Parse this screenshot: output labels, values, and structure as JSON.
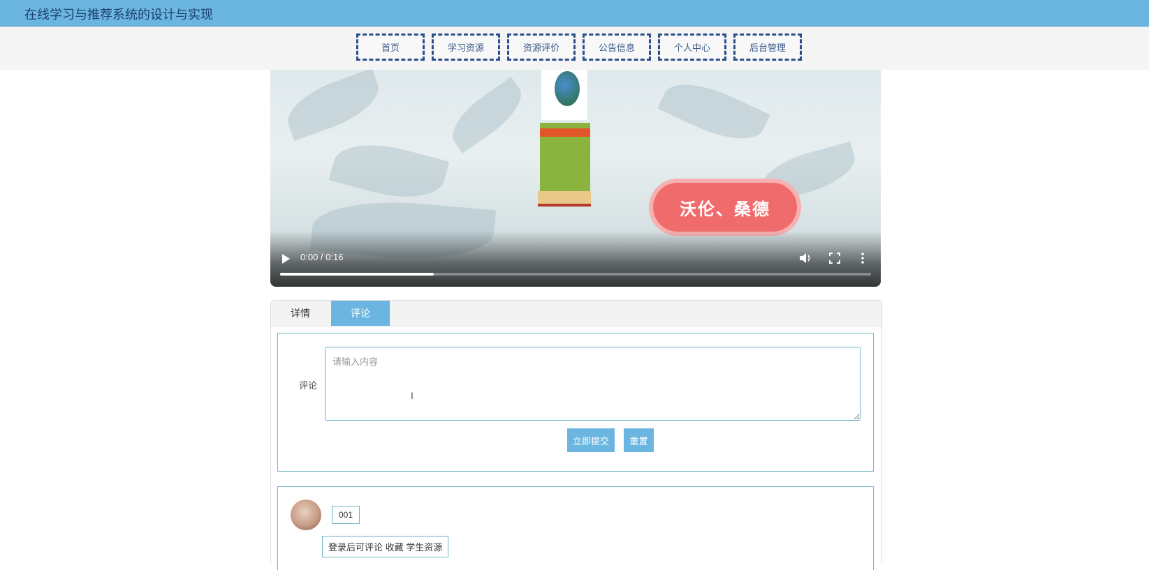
{
  "header": {
    "title": "在线学习与推荐系统的设计与实现"
  },
  "nav": {
    "items": [
      {
        "label": "首页"
      },
      {
        "label": "学习资源"
      },
      {
        "label": "资源评价"
      },
      {
        "label": "公告信息"
      },
      {
        "label": "个人中心"
      },
      {
        "label": "后台管理"
      }
    ]
  },
  "video": {
    "overlay_text": "沃伦、桑德",
    "time": "0:00 / 0:16",
    "progress_fraction": 0.26
  },
  "tabs": [
    {
      "label": "详情",
      "active": false
    },
    {
      "label": "评论",
      "active": true
    }
  ],
  "comment_form": {
    "label": "评论",
    "placeholder": "请输入内容",
    "submit_label": "立即提交",
    "reset_label": "重置"
  },
  "comments": [
    {
      "username": "001",
      "text": "登录后可评论 收藏 学生资源"
    }
  ],
  "colors": {
    "accent": "#6bb6e0",
    "nav_border": "#2c4f8a",
    "form_border": "#6fb4c8"
  }
}
